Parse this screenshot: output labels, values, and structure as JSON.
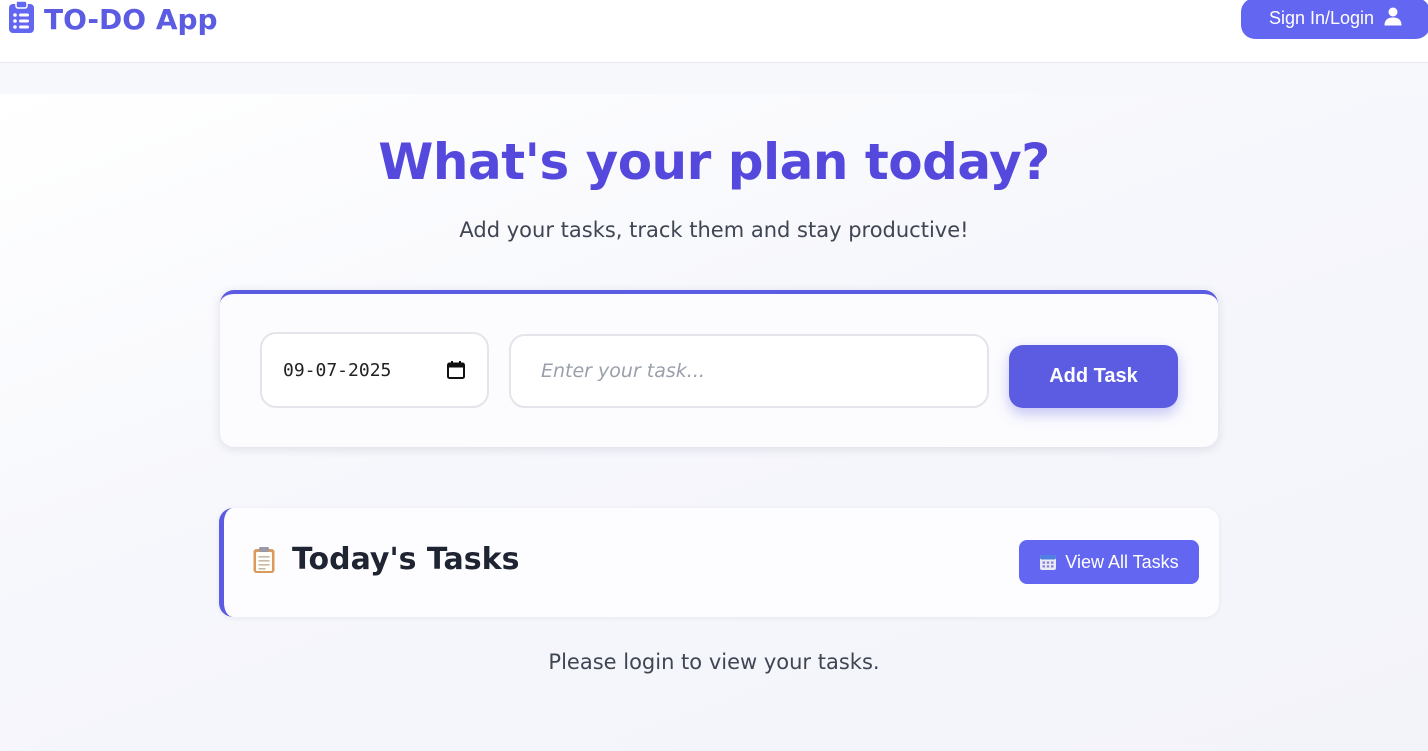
{
  "header": {
    "app_title": "TO-DO App",
    "signin_label": "Sign In/Login",
    "brand_color": "#5b5ce2"
  },
  "hero": {
    "headline": "What's your plan today?",
    "subline": "Add your tasks, track them and stay productive!"
  },
  "task_form": {
    "date_value": "09-07-2025",
    "task_placeholder": "Enter your task...",
    "task_value": "",
    "add_button_label": "Add Task"
  },
  "tasks_section": {
    "title": "Today's Tasks",
    "view_all_label": "View All Tasks",
    "empty_message": "Please login to view your tasks."
  },
  "icons": {
    "brand": "clipboard-list-icon",
    "signin": "user-icon",
    "date": "calendar-icon",
    "tasks": "clipboard-icon",
    "view_all": "calendar-icon"
  }
}
